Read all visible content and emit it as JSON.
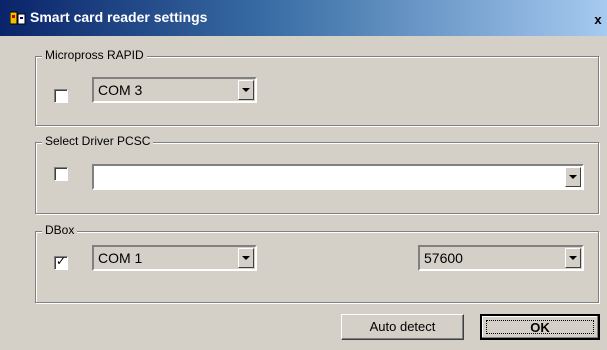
{
  "window": {
    "title": "Smart card reader settings",
    "close_glyph": "x"
  },
  "groups": {
    "micropross": {
      "label": "Micropross RAPID",
      "checked": false,
      "port": "COM 3"
    },
    "pcsc": {
      "label": "Select Driver PCSC",
      "checked": false,
      "driver": ""
    },
    "dbox": {
      "label": "DBox",
      "checked": true,
      "check_glyph": "✓",
      "port": "COM 1",
      "baud": "57600"
    }
  },
  "buttons": {
    "auto_detect": "Auto detect",
    "ok": "OK"
  },
  "colors": {
    "face": "#d4d0c8",
    "title_start": "#0a246a",
    "title_end": "#a6caf0"
  },
  "icons": {
    "title": "card-reader-icon",
    "close": "close-icon",
    "dropdown": "chevron-down-icon"
  }
}
